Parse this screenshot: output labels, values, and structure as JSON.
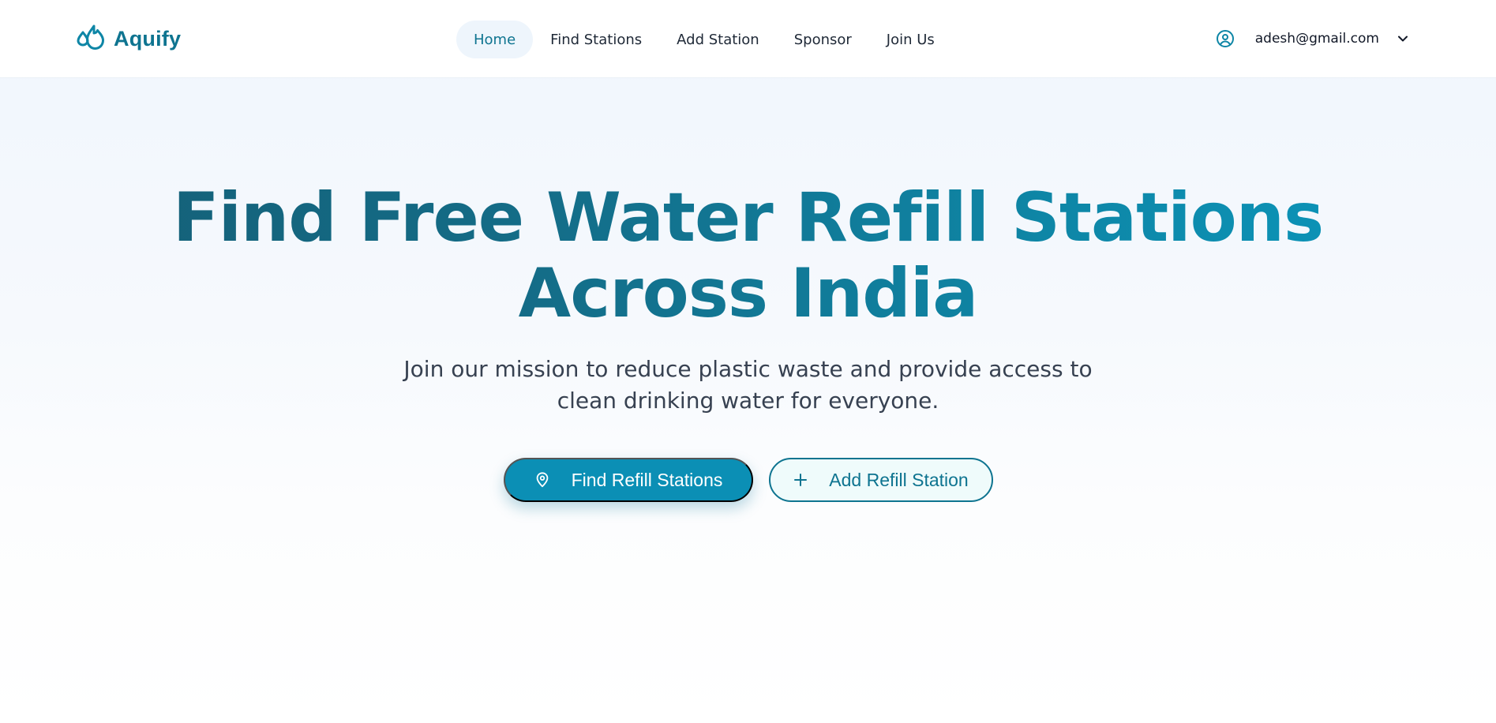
{
  "app": {
    "name": "Aquify",
    "logo_icon": "water-drops-icon"
  },
  "nav": {
    "items": [
      {
        "label": "Home",
        "active": true
      },
      {
        "label": "Find Stations",
        "active": false
      },
      {
        "label": "Add Station",
        "active": false
      },
      {
        "label": "Sponsor",
        "active": false
      },
      {
        "label": "Join Us",
        "active": false
      }
    ]
  },
  "user": {
    "email": "adesh@gmail.com",
    "icon": "user-circle-icon",
    "menu_icon": "chevron-down-icon"
  },
  "hero": {
    "title_line1": "Find Free Water Refill Stations",
    "title_line2": "Across India",
    "subtitle": "Join our mission to reduce plastic waste and provide access to clean drinking water for everyone.",
    "primary_button": {
      "label": "Find Refill Stations",
      "icon": "map-pin-icon"
    },
    "secondary_button": {
      "label": "Add Refill Station",
      "icon": "plus-icon"
    }
  },
  "colors": {
    "accent": "#0e7490",
    "primary_button": "#0b8fb5",
    "title_gradient_start": "#155e75",
    "title_gradient_end": "#0b99bf",
    "background": "#f0f6fd"
  }
}
